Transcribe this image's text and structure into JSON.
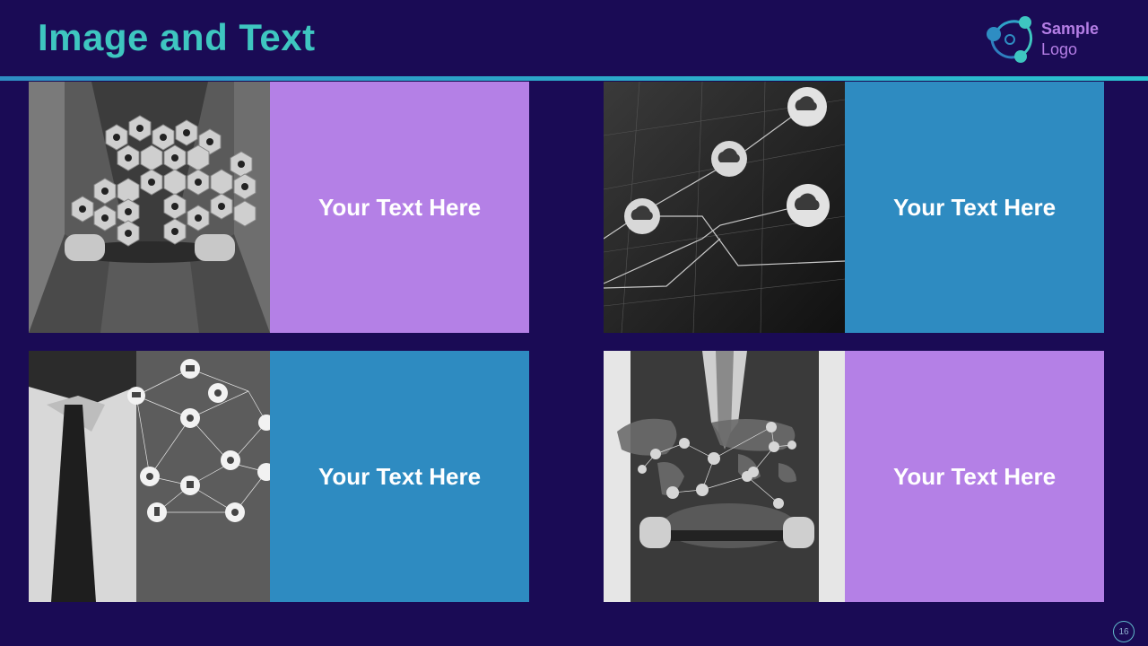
{
  "slide": {
    "title": "Image and Text",
    "page_number": "16"
  },
  "logo": {
    "line1": "Sample",
    "line2": "Logo",
    "icon": "network-nodes-logo-icon"
  },
  "colors": {
    "background": "#1a0b55",
    "title": "#3ec6c0",
    "purple_panel": "#b480e6",
    "blue_panel": "#2e8bc1",
    "rule": "#2ac2cf"
  },
  "cards": [
    {
      "text": "Your Text Here",
      "panel_color": "#b480e6",
      "image": "businessman-tablet-hexagon-icons-photo"
    },
    {
      "text": "Your Text Here",
      "panel_color": "#2e8bc1",
      "image": "cloud-download-circuit-photo"
    },
    {
      "text": "Your Text Here",
      "panel_color": "#2e8bc1",
      "image": "man-tie-network-globe-photo"
    },
    {
      "text": "Your Text Here",
      "panel_color": "#b480e6",
      "image": "businessman-tablet-world-map-photo"
    }
  ]
}
